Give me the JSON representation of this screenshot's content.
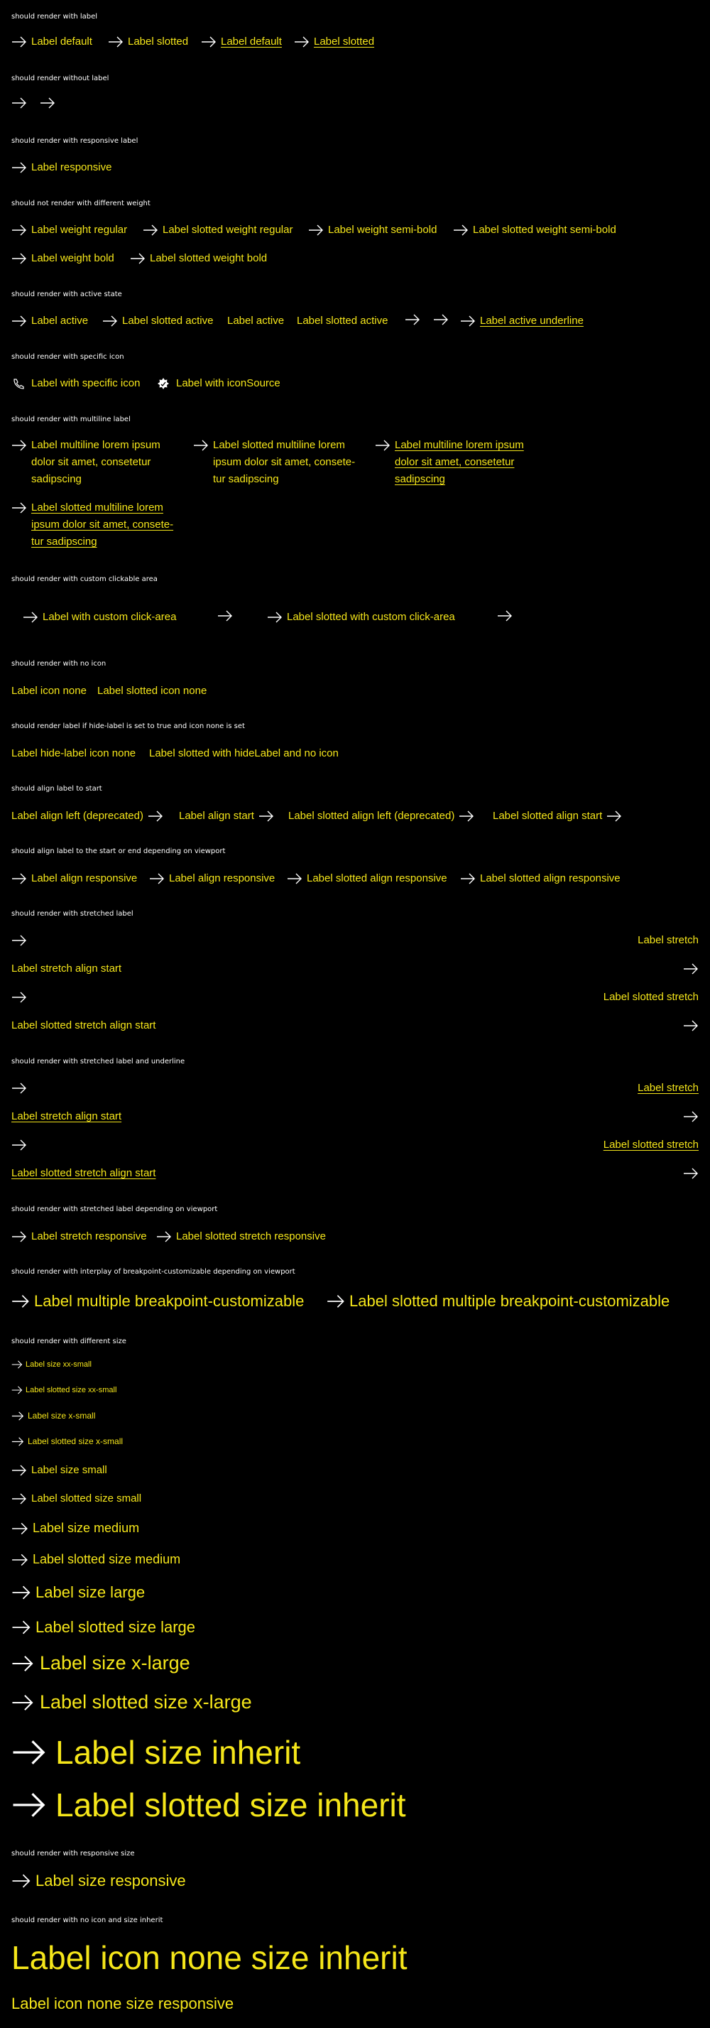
{
  "colors": {
    "background": "#000000",
    "link": "#f5e61a",
    "heading": "#ffffff"
  },
  "icons": {
    "arrow": "arrow-right-icon",
    "phone": "phone-icon",
    "custom": "badge-icon"
  },
  "sections": {
    "s1": {
      "heading": "should render with label",
      "items": [
        "Label default",
        "Label slotted",
        "Label default",
        "Label slotted"
      ]
    },
    "s2": {
      "heading": "should render without label"
    },
    "s3": {
      "heading": "should render with responsive label",
      "items": [
        "Label responsive"
      ]
    },
    "s4": {
      "heading": "should not render with different weight",
      "items": [
        "Label weight regular",
        "Label slotted weight regular",
        "Label weight semi-bold",
        "Label slotted weight semi-bold",
        "Label weight bold",
        "Label slotted weight bold"
      ]
    },
    "s5": {
      "heading": "should render with active state",
      "items": [
        "Label active",
        "Label slotted active",
        "Label active",
        "Label slotted active",
        "Label active underline"
      ]
    },
    "s6": {
      "heading": "should render with specific icon",
      "items": [
        "Label with specific icon",
        "Label with iconSource"
      ]
    },
    "s7": {
      "heading": "should render with multiline label",
      "items": [
        "Label multiline lorem ipsum dolor sit amet, consetetur sadipscing",
        "Label slotted multiline lorem ipsum dolor sit amet, consete-tur sadipscing",
        "Label multiline lorem ipsum dolor sit amet, consetetur sadipscing",
        "Label slotted multiline lorem ipsum dolor sit amet, consete-tur sadipscing"
      ]
    },
    "s8": {
      "heading": "should render with custom clickable area",
      "items": [
        "Label with custom click-area",
        "Label slotted with custom click-area"
      ]
    },
    "s9": {
      "heading": "should render with no icon",
      "items": [
        "Label icon none",
        "Label slotted icon none"
      ]
    },
    "s10": {
      "heading": "should render label if hide-label is set to true and icon none is set",
      "items": [
        "Label hide-label icon none",
        "Label slotted with hideLabel and no icon"
      ]
    },
    "s11": {
      "heading": "should align label to start",
      "items": [
        "Label align left (deprecated)",
        "Label align start",
        "Label slotted align left (deprecated)",
        "Label slotted align start"
      ]
    },
    "s12": {
      "heading": "should align label to the start or end depending on viewport",
      "items": [
        "Label align responsive",
        "Label align responsive",
        "Label slotted align responsive",
        "Label slotted align responsive"
      ]
    },
    "s13": {
      "heading": "should render with stretched label",
      "items": [
        "Label stretch",
        "Label stretch align start",
        "Label slotted stretch",
        "Label slotted stretch align start"
      ]
    },
    "s14": {
      "heading": "should render with stretched label and underline",
      "items": [
        "Label stretch",
        "Label stretch align start",
        "Label slotted stretch",
        "Label slotted stretch align start"
      ]
    },
    "s15": {
      "heading": "should render with stretched label depending on viewport",
      "items": [
        "Label stretch responsive",
        "Label slotted stretch responsive"
      ]
    },
    "s16": {
      "heading": "should render with interplay of breakpoint-customizable depending on viewport",
      "items": [
        "Label multiple breakpoint-customizable",
        "Label slotted multiple breakpoint-customizable"
      ]
    },
    "s17": {
      "heading": "should render with different size",
      "items": [
        "Label size xx-small",
        "Label slotted size xx-small",
        "Label size x-small",
        "Label slotted size x-small",
        "Label size small",
        "Label slotted size small",
        "Label size medium",
        "Label slotted size medium",
        "Label size large",
        "Label slotted size large",
        "Label size x-large",
        "Label slotted size x-large",
        "Label size inherit",
        "Label slotted size inherit"
      ]
    },
    "s18": {
      "heading": "should render with responsive size",
      "items": [
        "Label size responsive"
      ]
    },
    "s19": {
      "heading": "should render with no icon and size inherit",
      "items": [
        "Label icon none size inherit",
        "Label icon none size responsive"
      ]
    }
  }
}
